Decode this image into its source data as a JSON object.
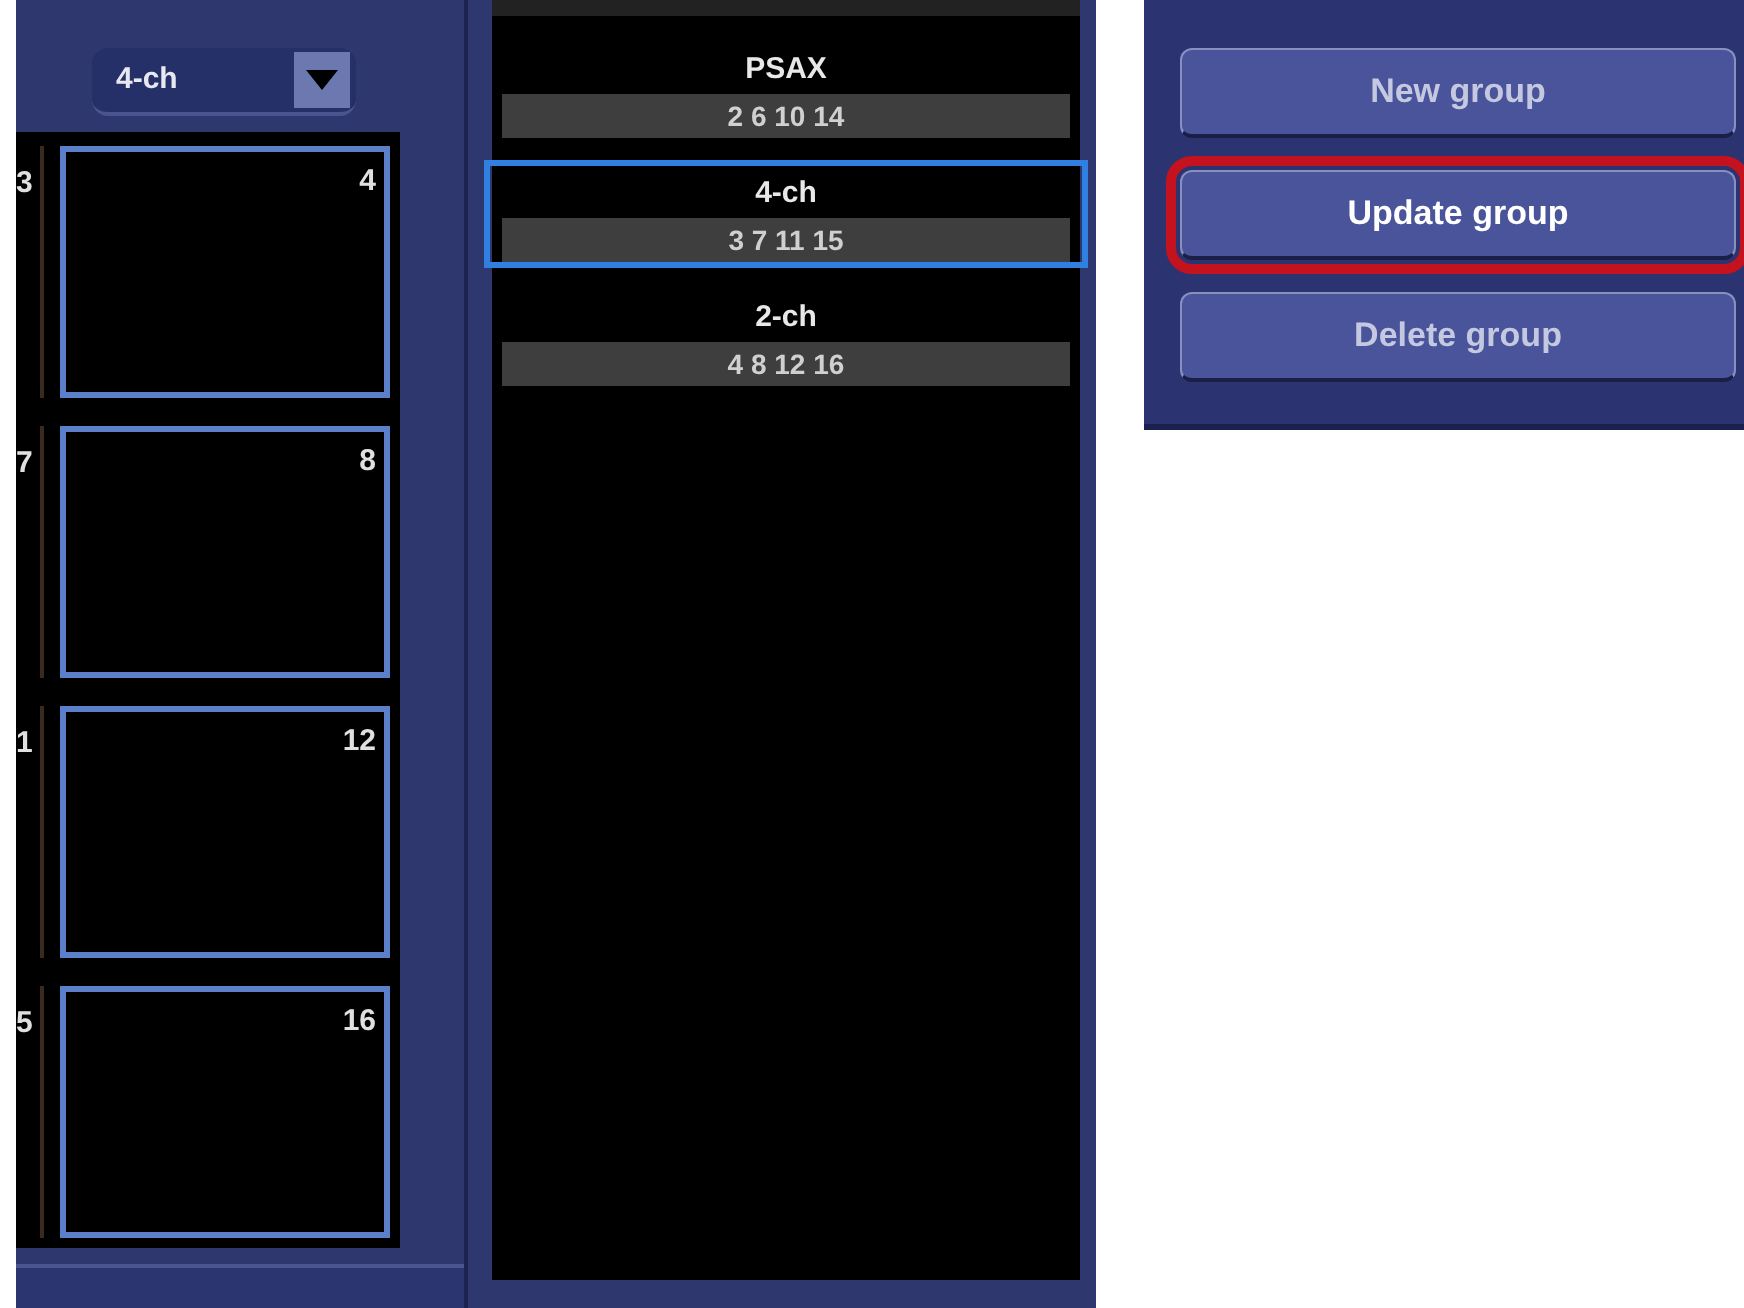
{
  "view_selector": {
    "value": "4-ch"
  },
  "thumbnail_rows": [
    {
      "left_number": "3",
      "right_number": "4"
    },
    {
      "left_number": "7",
      "right_number": "8"
    },
    {
      "left_number": "1",
      "right_number": "12"
    },
    {
      "left_number": "5",
      "right_number": "16"
    }
  ],
  "groups": [
    {
      "name": "PSAX",
      "views": "2 6 10 14",
      "selected": false
    },
    {
      "name": "4-ch",
      "views": "3 7 11 15",
      "selected": true
    },
    {
      "name": "2-ch",
      "views": "4 8 12 16",
      "selected": false
    }
  ],
  "buttons": [
    {
      "label": "New group",
      "highlighted": false
    },
    {
      "label": "Update group",
      "highlighted": true
    },
    {
      "label": "Delete group",
      "highlighted": false
    }
  ]
}
